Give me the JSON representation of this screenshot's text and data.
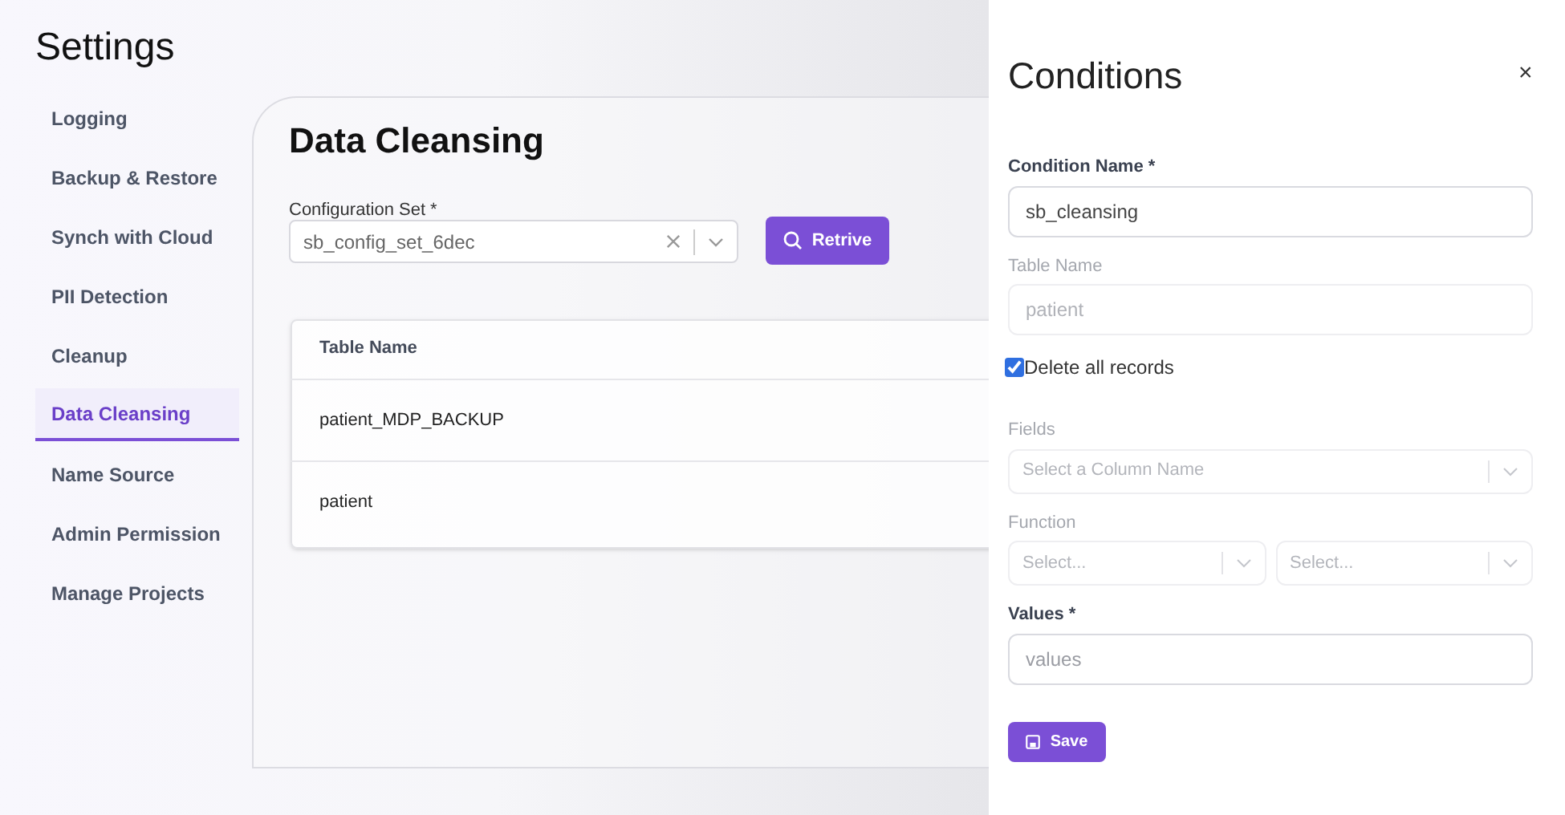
{
  "page": {
    "title": "Settings"
  },
  "sidebar": {
    "items": [
      {
        "label": "Logging",
        "selected": false
      },
      {
        "label": "Backup & Restore",
        "selected": false
      },
      {
        "label": "Synch with Cloud",
        "selected": false
      },
      {
        "label": "PII Detection",
        "selected": false
      },
      {
        "label": "Cleanup",
        "selected": false
      },
      {
        "label": "Data Cleansing",
        "selected": true
      },
      {
        "label": "Name Source",
        "selected": false
      },
      {
        "label": "Admin Permission",
        "selected": false
      },
      {
        "label": "Manage Projects",
        "selected": false
      }
    ]
  },
  "main": {
    "title": "Data Cleansing",
    "config_label": "Configuration Set *",
    "config_value": "sb_config_set_6dec",
    "retrieve_button": "Retrive",
    "table": {
      "columns": [
        "Table Name"
      ],
      "rows": [
        [
          "patient_MDP_BACKUP"
        ],
        [
          "patient"
        ]
      ]
    }
  },
  "panel": {
    "title": "Conditions",
    "close": "×",
    "fields": [
      {
        "kind": "input",
        "label": "Condition Name *",
        "value": "sb_cleansing",
        "disabled": false
      },
      {
        "kind": "input",
        "label": "Table Name",
        "value": "patient",
        "disabled": true
      },
      {
        "kind": "checkbox",
        "label": "Delete all records",
        "checked": true
      },
      {
        "kind": "select",
        "label": "Fields",
        "placeholders": [
          "Select a Column Name"
        ],
        "disabled": true
      },
      {
        "kind": "select",
        "label": "Function",
        "placeholders": [
          "Select...",
          "Select..."
        ],
        "disabled": true
      },
      {
        "kind": "input",
        "label": "Values *",
        "placeholder": "values",
        "disabled": false
      }
    ],
    "save_button": "Save"
  }
}
